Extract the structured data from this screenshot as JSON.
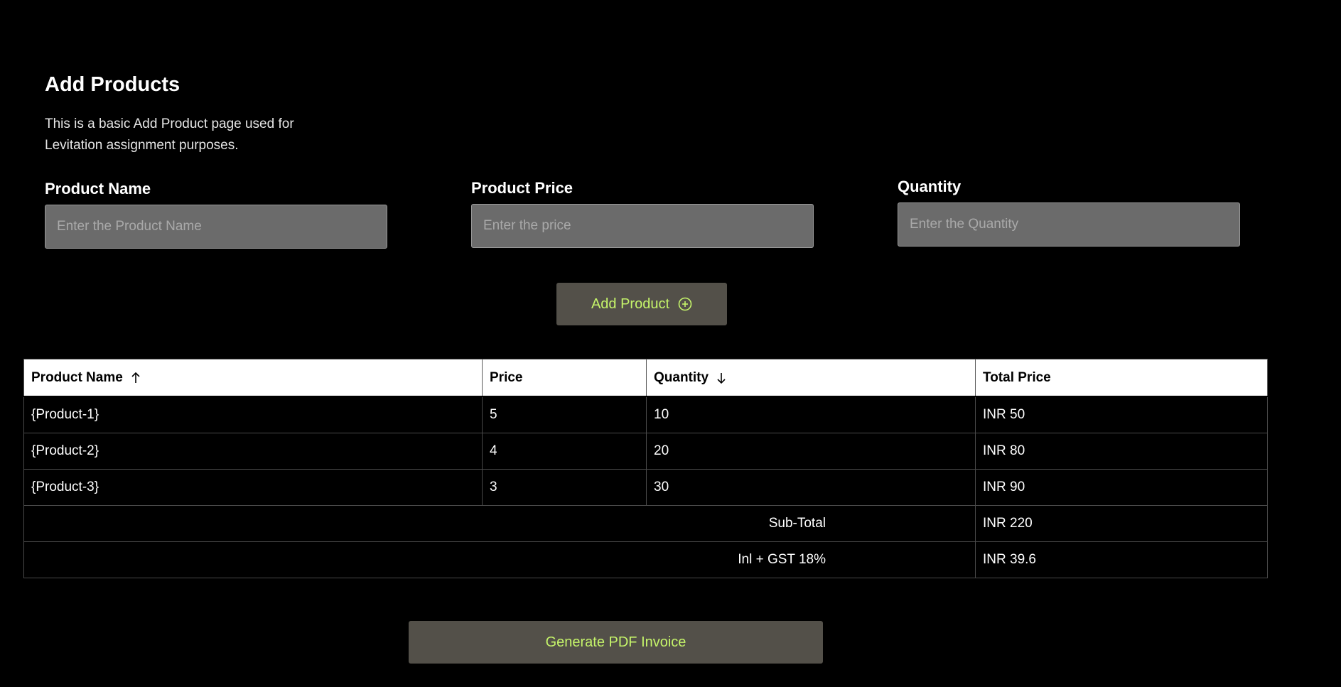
{
  "header": {
    "title": "Add Products",
    "description": "This is a basic Add Product page used for Levitation assignment purposes."
  },
  "form": {
    "product_name": {
      "label": "Product Name",
      "placeholder": "Enter the Product Name",
      "value": ""
    },
    "product_price": {
      "label": "Product Price",
      "placeholder": "Enter the price",
      "value": ""
    },
    "quantity": {
      "label": "Quantity",
      "placeholder": "Enter the Quantity",
      "value": ""
    },
    "add_button": {
      "label": "Add Product",
      "icon": "plus-circle-icon"
    }
  },
  "table": {
    "columns": [
      {
        "label": "Product Name",
        "sort_icon": "arrow-up-icon"
      },
      {
        "label": "Price"
      },
      {
        "label": "Quantity",
        "sort_icon": "arrow-down-icon"
      },
      {
        "label": "Total Price"
      }
    ],
    "rows": [
      {
        "name": "{Product-1}",
        "price": "5",
        "quantity": "10",
        "total": "INR 50"
      },
      {
        "name": "{Product-2}",
        "price": "4",
        "quantity": "20",
        "total": "INR 80"
      },
      {
        "name": "{Product-3}",
        "price": "3",
        "quantity": "30",
        "total": "INR 90"
      }
    ],
    "summary": [
      {
        "label": "Sub-Total",
        "value": "INR 220"
      },
      {
        "label": "Inl + GST 18%",
        "value": "INR 39.6"
      }
    ]
  },
  "footer": {
    "generate_button": "Generate PDF Invoice"
  },
  "colors": {
    "background": "#000000",
    "accent_text": "#c5f46a",
    "button_bg": "#535049",
    "input_bg": "#6b6b6b"
  }
}
